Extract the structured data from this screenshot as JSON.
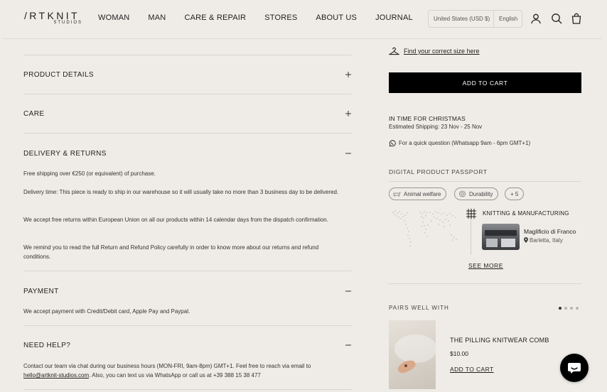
{
  "brand": {
    "logo_main": "/RTKNIT",
    "logo_sub": "STUDIOS"
  },
  "nav": {
    "items": [
      "WOMAN",
      "MAN",
      "CARE & REPAIR",
      "STORES",
      "ABOUT US",
      "JOURNAL"
    ]
  },
  "locale": {
    "country": "United States (USD $)",
    "language": "English"
  },
  "header_icons": [
    "account-icon",
    "search-icon",
    "bag-icon"
  ],
  "accordion": {
    "product_details": {
      "title": "PRODUCT DETAILS",
      "state": "+"
    },
    "care": {
      "title": "CARE",
      "state": "+"
    },
    "delivery": {
      "title": "DELIVERY & RETURNS",
      "state": "−",
      "paragraphs": [
        "Free shipping over €250 (or equivalent) of purchase.",
        "Delivery time: This piece is ready to ship in our warehouse so it will usually take no more than 3 business day to be delivered.",
        "We accept free returns within European Union on all our products within 14 calendar days from the dispatch confirmation.",
        "We remind you to read the full Return and Refund Policy carefully in order to know more about our returns and refund conditions."
      ]
    },
    "payment": {
      "title": "PAYMENT",
      "state": "−",
      "text": "We accept payment with Credit/Debit card, Apple Pay and Paypal."
    },
    "help": {
      "title": "NEED HELP?",
      "state": "−",
      "text_before": "Contact our team via chat during our business hours (MON-FRI, 9am-8pm) GMT+1. Feel free to reach via email to ",
      "email": "hello@artknit-studios.com",
      "text_after": ". Also, you can text us via WhatsApp or call us at +39 388 15 38 477"
    }
  },
  "buy_box": {
    "size_link": "Find your correct size here",
    "add_to_cart": "ADD TO CART",
    "christmas_title": "IN TIME FOR CHRISTMAS",
    "shipping": "Estimated Shipping: 23 Nov - 25 Nov",
    "whatsapp": "For a quick question (Whatsapp 9am - 6pm GMT+1)"
  },
  "passport": {
    "title": "DIGITAL PRODUCT PASSPORT",
    "pills": [
      "Animal welfare",
      "Durability",
      "+ 5"
    ],
    "knitting_title": "KNITTING & MANUFACTURING",
    "mill_name": "Maglificio di Franco",
    "mill_location": "Barletta, Italy",
    "see_more": "SEE MORE"
  },
  "pairs": {
    "title": "PAIRS WELL WITH",
    "slide_count": 4,
    "active_slide": 1,
    "product_name": "THE PILLING KNITWEAR COMB",
    "price": "$10.00",
    "add_to_cart": "ADD TO CART"
  },
  "colors": {
    "background": "#efece7",
    "button": "#000000",
    "text": "#1f1f1f",
    "rule": "#d9d5cf"
  }
}
